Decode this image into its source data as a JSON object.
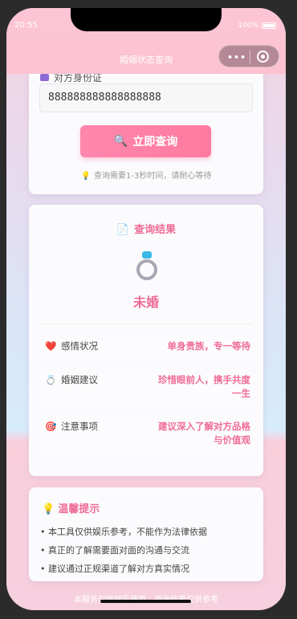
{
  "status_bar": {
    "time": "20:55",
    "battery": "100%"
  },
  "navbar": {
    "title": "婚姻状态查询"
  },
  "query_form": {
    "id_label": "对方身份证",
    "id_value": "888888888888888888",
    "button_label": "立即查询",
    "hint": "查询需要1-3秒时间，请耐心等待"
  },
  "result": {
    "title": "查询结果",
    "status": "未婚",
    "rows": [
      {
        "icon": "heart-icon",
        "label": "感情状况",
        "value": "单身贵族，专一等待"
      },
      {
        "icon": "ring-icon",
        "label": "婚姻建议",
        "value": "珍惜眼前人，携手共度一生"
      },
      {
        "icon": "target-icon",
        "label": "注意事项",
        "value": "建议深入了解对方品格与价值观"
      }
    ]
  },
  "tips": {
    "title": "温馨提示",
    "items": [
      "本工具仅供娱乐参考，不能作为法律依据",
      "真正的了解需要面对面的沟通与交流",
      "建议通过正规渠道了解对方真实情况"
    ]
  },
  "footer": {
    "text": "本服务仅供娱乐使用，查询结果仅供参考"
  },
  "colors": {
    "accent": "#ef6c98",
    "button": "#ff7fa6",
    "navbar": "#fcc4d4"
  }
}
